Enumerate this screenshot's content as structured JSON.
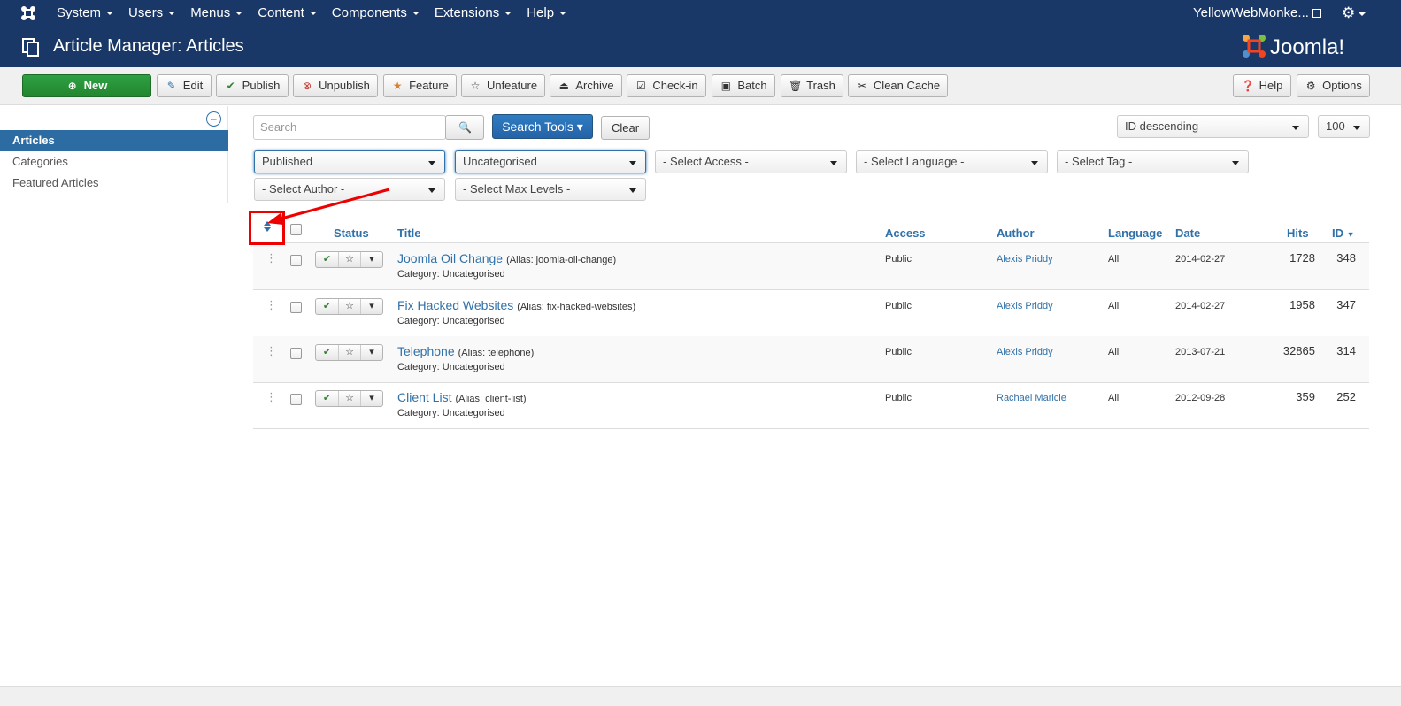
{
  "navbar": {
    "menu": [
      "System",
      "Users",
      "Menus",
      "Content",
      "Components",
      "Extensions",
      "Help"
    ],
    "user": "YellowWebMonke..."
  },
  "header": {
    "title": "Article Manager: Articles",
    "logo_text": "Joomla!"
  },
  "toolbar": {
    "new": "New",
    "edit": "Edit",
    "publish": "Publish",
    "unpublish": "Unpublish",
    "feature": "Feature",
    "unfeature": "Unfeature",
    "archive": "Archive",
    "checkin": "Check-in",
    "batch": "Batch",
    "trash": "Trash",
    "clean_cache": "Clean Cache",
    "help": "Help",
    "options": "Options"
  },
  "sidebar": {
    "items": [
      {
        "label": "Articles",
        "active": true
      },
      {
        "label": "Categories",
        "active": false
      },
      {
        "label": "Featured Articles",
        "active": false
      }
    ]
  },
  "search": {
    "placeholder": "Search",
    "tools_label": "Search Tools",
    "clear_label": "Clear",
    "ordering": "ID descending",
    "limit": "100"
  },
  "filters": {
    "published": "Published",
    "category": "Uncategorised",
    "access": "- Select Access -",
    "language": "- Select Language -",
    "tag": "- Select Tag -",
    "author": "- Select Author -",
    "max_levels": "- Select Max Levels -"
  },
  "table": {
    "headers": {
      "status": "Status",
      "title": "Title",
      "access": "Access",
      "author": "Author",
      "language": "Language",
      "date": "Date",
      "hits": "Hits",
      "id": "ID"
    },
    "rows": [
      {
        "title": "Joomla Oil Change",
        "alias": "(Alias: joomla-oil-change)",
        "category": "Category: Uncategorised",
        "access": "Public",
        "author": "Alexis Priddy",
        "language": "All",
        "date": "2014-02-27",
        "hits": "1728",
        "id": "348"
      },
      {
        "title": "Fix Hacked Websites",
        "alias": "(Alias: fix-hacked-websites)",
        "category": "Category: Uncategorised",
        "access": "Public",
        "author": "Alexis Priddy",
        "language": "All",
        "date": "2014-02-27",
        "hits": "1958",
        "id": "347"
      },
      {
        "title": "Telephone",
        "alias": "(Alias: telephone)",
        "category": "Category: Uncategorised",
        "access": "Public",
        "author": "Alexis Priddy",
        "language": "All",
        "date": "2013-07-21",
        "hits": "32865",
        "id": "314"
      },
      {
        "title": "Client List",
        "alias": "(Alias: client-list)",
        "category": "Category: Uncategorised",
        "access": "Public",
        "author": "Rachael Maricle",
        "language": "All",
        "date": "2012-09-28",
        "hits": "359",
        "id": "252"
      }
    ]
  },
  "colors": {
    "navbar": "#1a3867",
    "accent": "#3071a9",
    "new_button": "#2ea043",
    "annotation": "#e00000"
  }
}
